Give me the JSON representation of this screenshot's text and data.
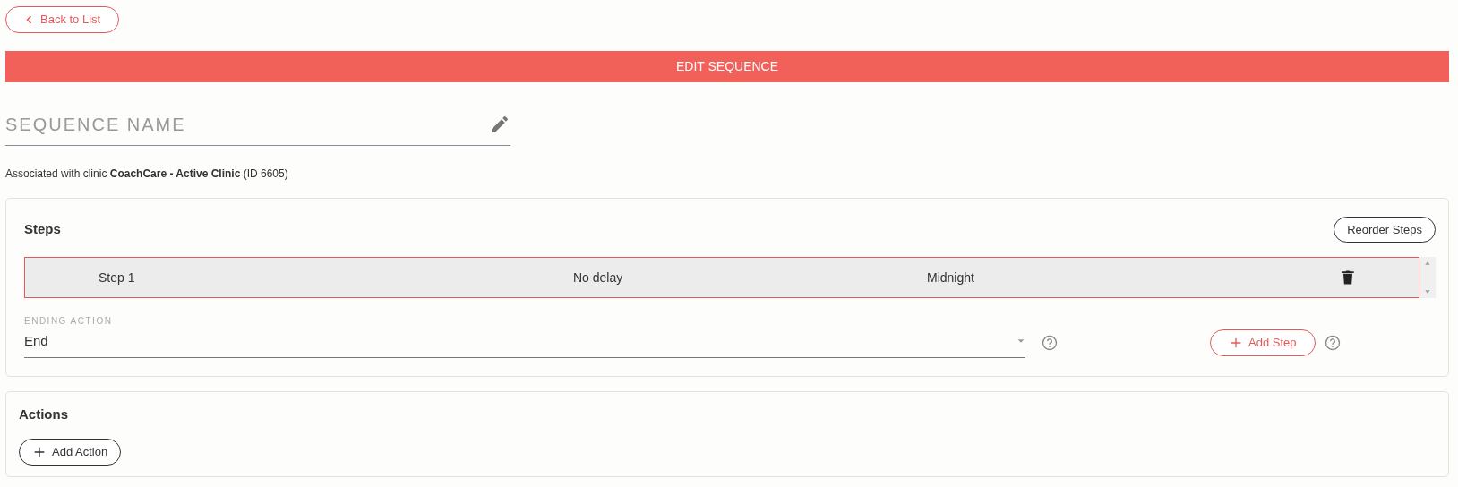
{
  "back_button": {
    "label": "Back to List"
  },
  "header": {
    "title": "EDIT SEQUENCE"
  },
  "name_field": {
    "placeholder": "SEQUENCE NAME"
  },
  "association": {
    "text": "Associated with clinic **CoachCare - Active Clinic** (ID 6605)"
  },
  "steps_panel": {
    "title": "Steps",
    "reorder_button": "Reorder Steps",
    "steps": [
      {
        "name": "Step 1",
        "delay": "No delay",
        "time": "Midnight",
        "selected": true
      }
    ],
    "ending_action": {
      "label": "ENDING ACTION",
      "value": "End"
    },
    "add_step_button": "Add Step"
  },
  "actions_panel": {
    "title": "Actions",
    "add_action_button": "Add Action"
  }
}
